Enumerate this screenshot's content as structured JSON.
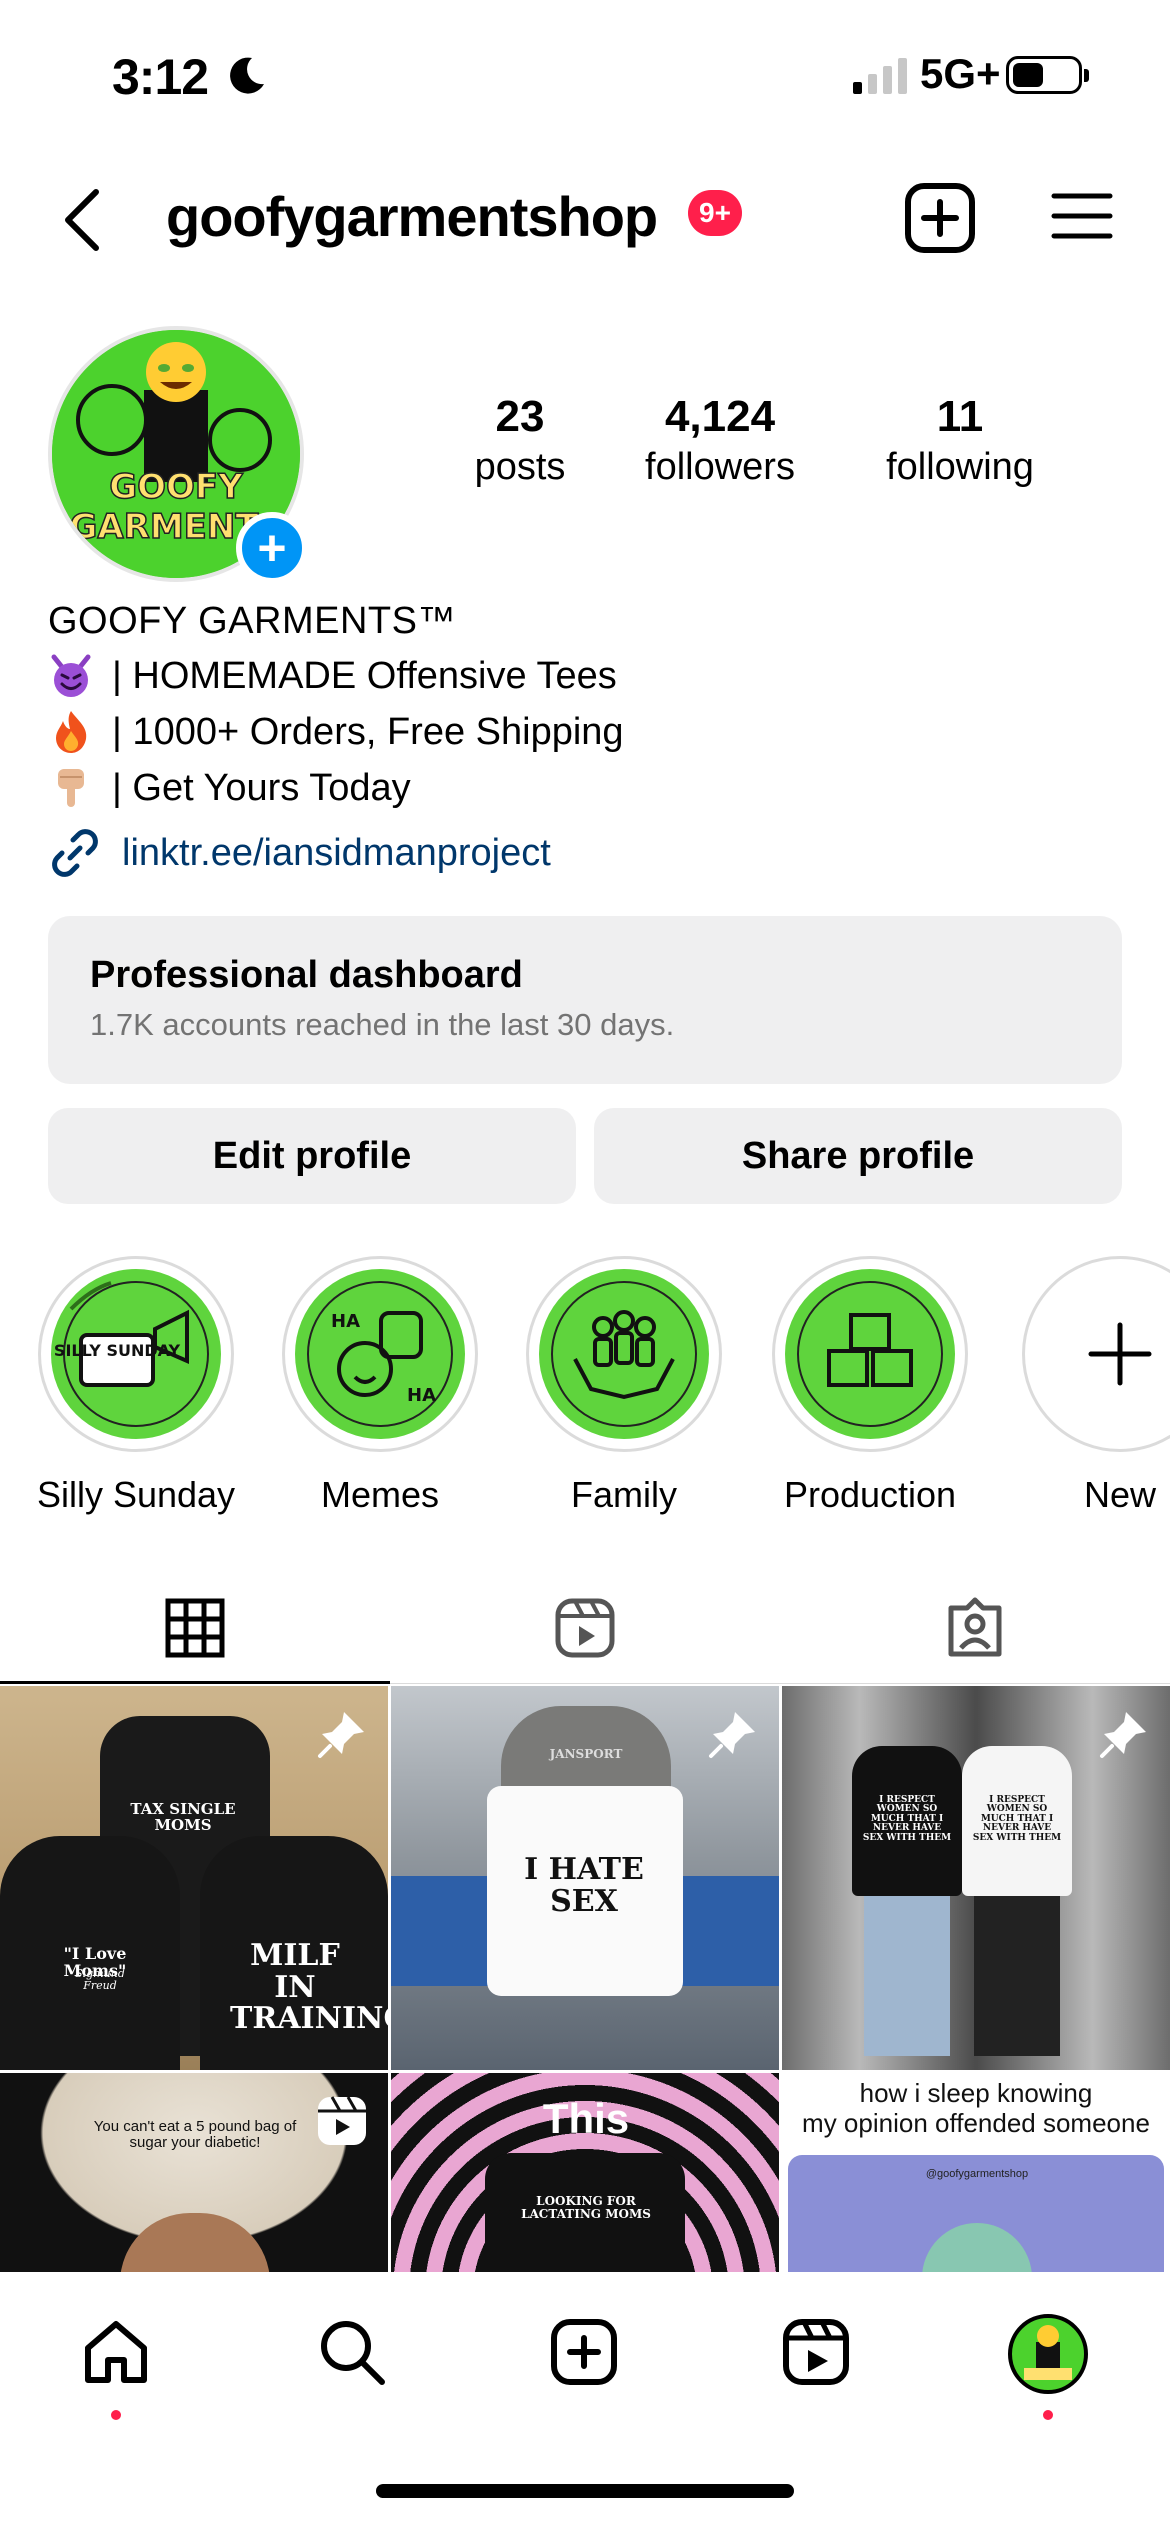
{
  "status_bar": {
    "time": "3:12",
    "network": "5G+"
  },
  "header": {
    "username": "goofygarmentshop",
    "notification_badge": "9+"
  },
  "profile": {
    "avatar_text": "GOOFY GARMENTS",
    "stats": [
      {
        "value": "23",
        "label": "posts"
      },
      {
        "value": "4,124",
        "label": "followers"
      },
      {
        "value": "11",
        "label": "following"
      }
    ],
    "name": "GOOFY GARMENTS™",
    "bio_lines": [
      {
        "emoji": "smiling-devil",
        "text": "| HOMEMADE Offensive Tees"
      },
      {
        "emoji": "fire",
        "text": "| 1000+ Orders, Free Shipping"
      },
      {
        "emoji": "pointing-down",
        "text": "| Get Yours Today"
      }
    ],
    "link": "linktr.ee/iansidmanproject"
  },
  "dashboard": {
    "title": "Professional dashboard",
    "subtitle": "1.7K accounts reached in the last 30 days."
  },
  "buttons": {
    "edit": "Edit profile",
    "share": "Share profile"
  },
  "highlights": [
    {
      "label": "Silly Sunday",
      "icon": "megaphone-icon",
      "art_text": "SILLY SUNDAY"
    },
    {
      "label": "Memes",
      "icon": "laughing-faces-icon",
      "art_text_1": "HA",
      "art_text_2": "HA"
    },
    {
      "label": "Family",
      "icon": "family-hands-icon"
    },
    {
      "label": "Production",
      "icon": "boxes-icon"
    },
    {
      "label": "New",
      "icon": "plus-icon"
    }
  ],
  "grid": {
    "posts": [
      {
        "shirt_text_1": "TAX SINGLE MOMS",
        "shirt_text_2": "\"I Love Moms\"",
        "shirt_text_3": "MILF IN TRAINING",
        "signature": "Sigmund Freud",
        "pinned": true
      },
      {
        "shirt_text": "I HATE SEX",
        "hoodie_text": "JANSPORT",
        "pinned": true
      },
      {
        "shirt_text_1": "I RESPECT WOMEN SO MUCH THAT I NEVER HAVE SEX WITH THEM",
        "shirt_text_2": "I RESPECT WOMEN SO MUCH THAT I NEVER HAVE SEX WITH THEM",
        "pinned": true
      },
      {
        "caption": "You can't eat a 5 pound bag of sugar your diabetic!",
        "type": "reel"
      },
      {
        "caption": "This",
        "shirt_text": "LOOKING FOR LACTATING MOMS"
      },
      {
        "caption_1": "how i sleep knowing",
        "caption_2": "my opinion offended someone",
        "watermark": "@goofygarmentshop"
      }
    ]
  },
  "colors": {
    "accent_green": "#5fd43d",
    "badge_red": "#ff1f4b",
    "link_blue": "#00376b",
    "add_blue": "#0095f6"
  }
}
